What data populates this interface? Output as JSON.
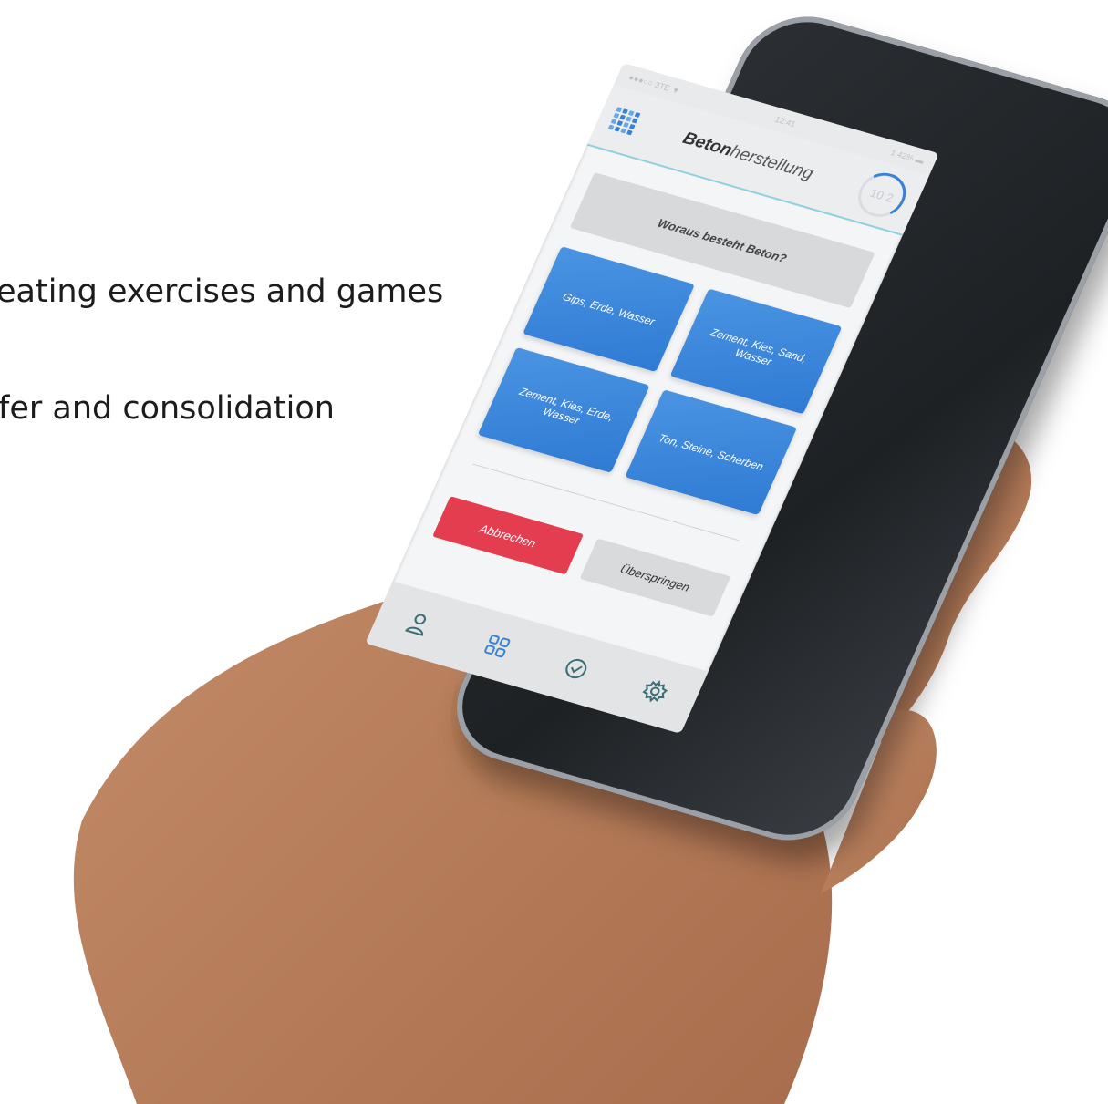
{
  "slide": {
    "line1": "eating exercises and games",
    "line2": "fer and consolidation"
  },
  "phone": {
    "status": {
      "carrier": "●●●○○ 3TE ▼",
      "time": "12:41",
      "battery": "1 42% ▬"
    },
    "header": {
      "title_bold": "Beton",
      "title_rest": "herstellung",
      "timer": "10 2"
    },
    "question": "Woraus besteht Beton?",
    "answers": [
      "Gips, Erde, Wasser",
      "Zement, Kies, Sand, Wasser",
      "Zement, Kies, Erde, Wasser",
      "Ton, Steine, Scherben"
    ],
    "actions": {
      "cancel": "Abbrechen",
      "skip": "Überspringen"
    },
    "tabs": [
      "profile-icon",
      "grid-icon",
      "check-icon",
      "gear-icon"
    ],
    "colors": {
      "accent": "#3b82d4",
      "danger": "#e43d50"
    }
  }
}
